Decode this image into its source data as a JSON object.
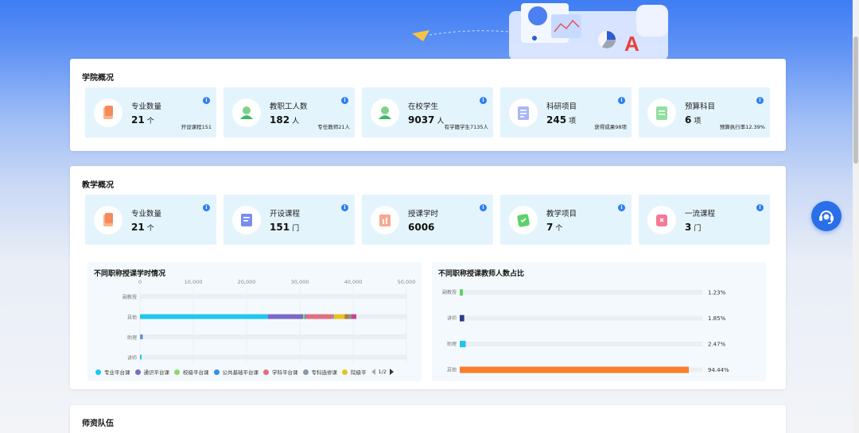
{
  "college_overview": {
    "title": "学院概况",
    "stats": [
      {
        "icon": "majors-icon",
        "label": "专业数量",
        "value": "21",
        "unit": "个",
        "sub": "开设课程151"
      },
      {
        "icon": "staff-icon",
        "label": "教职工人数",
        "value": "182",
        "unit": "人",
        "sub": "专任教师21人"
      },
      {
        "icon": "students-icon",
        "label": "在校学生",
        "value": "9037",
        "unit": "人",
        "sub": "有学籍学生7135人"
      },
      {
        "icon": "research-icon",
        "label": "科研项目",
        "value": "245",
        "unit": "项",
        "sub": "获得成果98项"
      },
      {
        "icon": "budget-icon",
        "label": "预算科目",
        "value": "6",
        "unit": "项",
        "sub": "预算执行率12.39%"
      }
    ]
  },
  "teaching_overview": {
    "title": "教学概况",
    "stats": [
      {
        "icon": "majors-icon",
        "label": "专业数量",
        "value": "21",
        "unit": "个"
      },
      {
        "icon": "courses-icon",
        "label": "开设课程",
        "value": "151",
        "unit": "门"
      },
      {
        "icon": "hours-icon",
        "label": "授课学时",
        "value": "6006",
        "unit": ""
      },
      {
        "icon": "projects-icon",
        "label": "教学项目",
        "value": "7",
        "unit": "个"
      },
      {
        "icon": "excellent-course-icon",
        "label": "一流课程",
        "value": "3",
        "unit": "门"
      }
    ]
  },
  "teachers_section": {
    "title": "师资队伍"
  },
  "colors": {
    "accent": "#2f7ef6",
    "stat_bg": "#e4f4fd",
    "bar_track": "#ebeef2",
    "pct_bar_colors": [
      "#5fd363",
      "#2d3a8c",
      "#1fc6e8",
      "#fb7d2e"
    ]
  },
  "chart_data": [
    {
      "type": "bar",
      "orientation": "horizontal",
      "stacked": true,
      "title": "不同职称授课学时情况",
      "categories": [
        "副教授",
        "其他",
        "助理",
        "讲师"
      ],
      "x_ticks": [
        "0",
        "10,000",
        "20,000",
        "30,000",
        "40,000",
        "50,000"
      ],
      "xlim": [
        0,
        50000
      ],
      "series": [
        {
          "name": "专业平台课",
          "color": "#1fc6f0",
          "values": [
            0,
            24000,
            200,
            300
          ]
        },
        {
          "name": "通识平台课",
          "color": "#7b68c8",
          "values": [
            0,
            6600,
            300,
            0
          ]
        },
        {
          "name": "校级平台课",
          "color": "#8ad86a",
          "values": [
            0,
            300,
            0,
            0
          ]
        },
        {
          "name": "公共基础平台课",
          "color": "#2f8fe8",
          "values": [
            0,
            200,
            0,
            0
          ]
        },
        {
          "name": "学科平台课",
          "color": "#e06f80",
          "values": [
            0,
            5000,
            0,
            0
          ]
        },
        {
          "name": "专科选修课",
          "color": "#8a95a8",
          "values": [
            0,
            300,
            0,
            0
          ]
        },
        {
          "name": "院级平",
          "color": "#e6c41e",
          "values": [
            0,
            2000,
            0,
            0
          ]
        },
        {
          "name": "",
          "color": "#b27a3a",
          "values": [
            0,
            800,
            0,
            0
          ]
        },
        {
          "name": "",
          "color": "#868e96",
          "values": [
            0,
            500,
            0,
            0
          ]
        },
        {
          "name": "",
          "color": "#c04a90",
          "values": [
            0,
            900,
            0,
            0
          ]
        }
      ],
      "legend_page": "1/2",
      "grid": true
    },
    {
      "type": "bar",
      "orientation": "horizontal",
      "title": "不同职称授课教师人数占比",
      "categories": [
        "副教授",
        "讲师",
        "助理",
        "其他"
      ],
      "values": [
        1.23,
        1.85,
        2.47,
        94.44
      ],
      "value_labels": [
        "1.23%",
        "1.85%",
        "2.47%",
        "94.44%"
      ],
      "xlim": [
        0,
        100
      ]
    }
  ]
}
